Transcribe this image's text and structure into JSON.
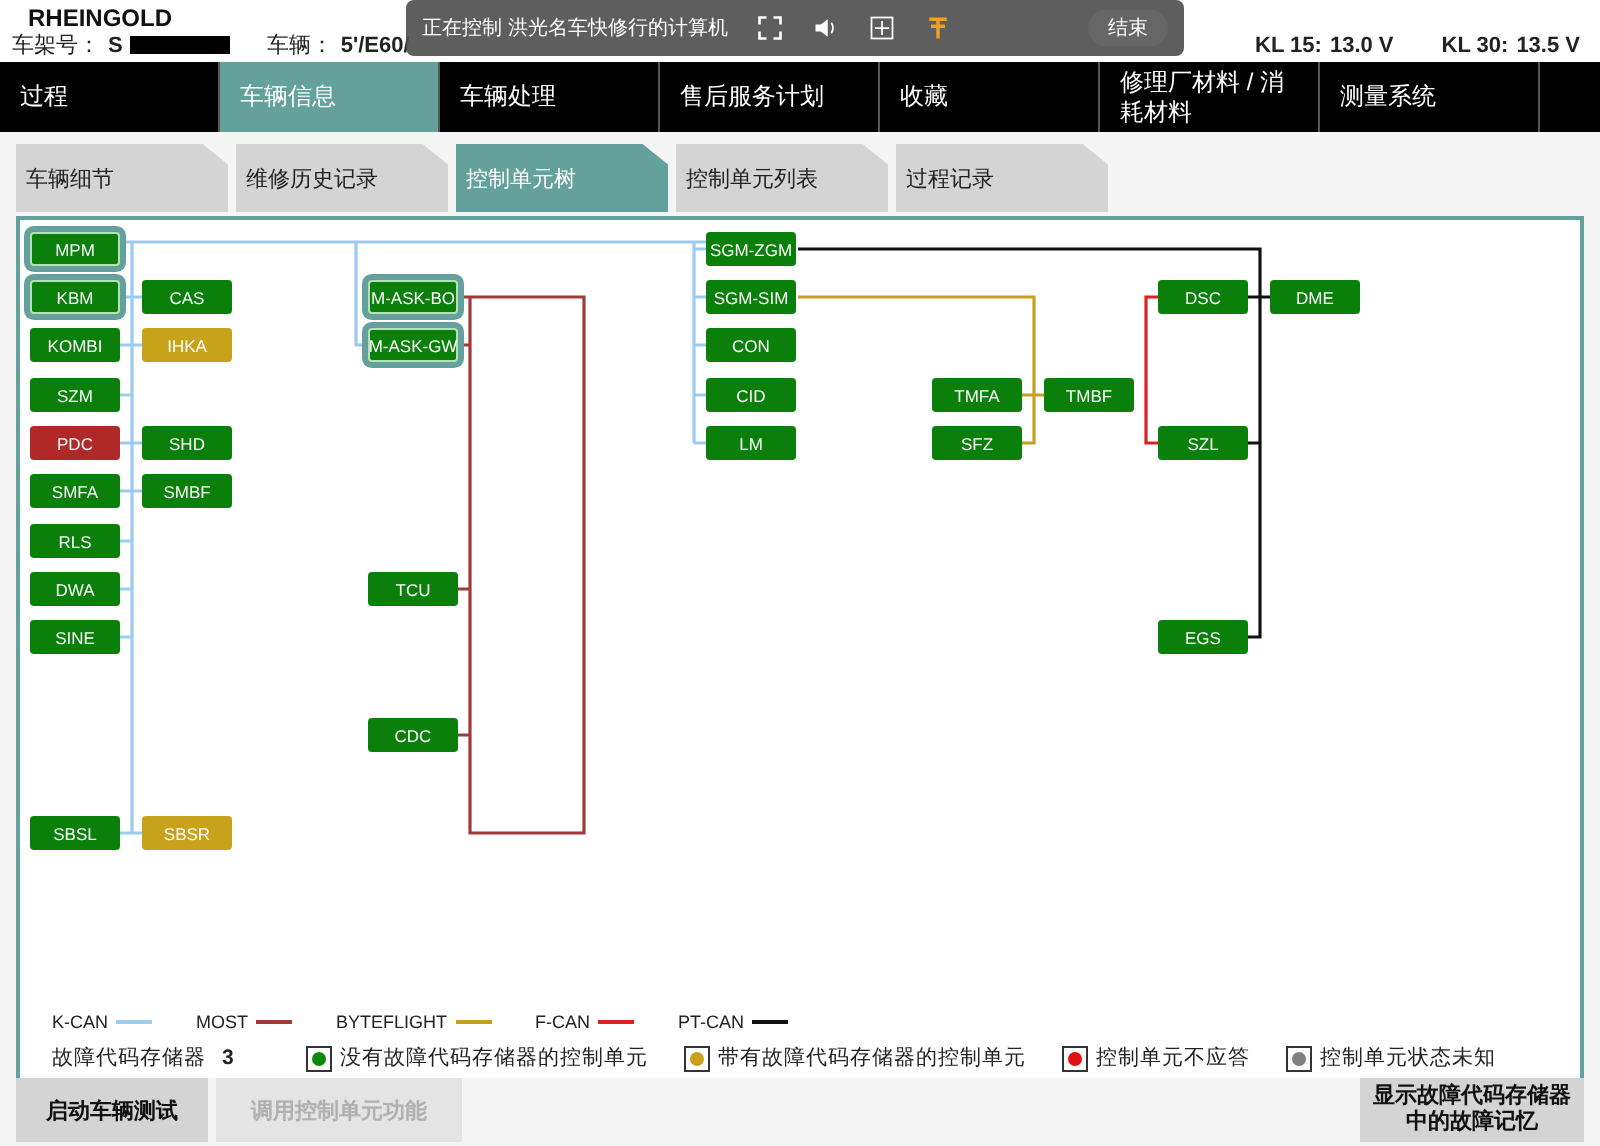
{
  "app_title": "RHEINGOLD",
  "vehicle_bar": {
    "chassis_label": "车架号：",
    "chassis_value": "S",
    "vehicle_label": "车辆：",
    "vehicle_value": "5'/E60/",
    "kl15_label": "KL 15:",
    "kl15_value": "13.0 V",
    "kl30_label": "KL 30:",
    "kl30_value": "13.5 V"
  },
  "remote_toolbar": {
    "text": "正在控制 洪光名车快修行的计算机",
    "end_button": "结束"
  },
  "menu": [
    {
      "label": "过程",
      "selected": false
    },
    {
      "label": "车辆信息",
      "selected": true
    },
    {
      "label": "车辆处理",
      "selected": false
    },
    {
      "label": "售后服务计划",
      "selected": false
    },
    {
      "label": "收藏",
      "selected": false
    },
    {
      "label": "修理厂材料 / 消耗材料",
      "selected": false
    },
    {
      "label": "测量系统",
      "selected": false
    }
  ],
  "tabs": [
    {
      "label": "车辆细节",
      "selected": false
    },
    {
      "label": "维修历史记录",
      "selected": false
    },
    {
      "label": "控制单元树",
      "selected": true
    },
    {
      "label": "控制单元列表",
      "selected": false
    },
    {
      "label": "过程记录",
      "selected": false
    }
  ],
  "nodes": [
    {
      "label": "MPM",
      "kind": "ok",
      "highlighted": true
    },
    {
      "label": "KBM",
      "kind": "ok",
      "highlighted": true
    },
    {
      "label": "CAS",
      "kind": "ok",
      "highlighted": false
    },
    {
      "label": "KOMBI",
      "kind": "ok",
      "highlighted": false
    },
    {
      "label": "IHKA",
      "kind": "fault",
      "highlighted": false
    },
    {
      "label": "SZM",
      "kind": "ok",
      "highlighted": false
    },
    {
      "label": "PDC",
      "kind": "no_response",
      "highlighted": false
    },
    {
      "label": "SHD",
      "kind": "ok",
      "highlighted": false
    },
    {
      "label": "SMFA",
      "kind": "ok",
      "highlighted": false
    },
    {
      "label": "SMBF",
      "kind": "ok",
      "highlighted": false
    },
    {
      "label": "RLS",
      "kind": "ok",
      "highlighted": false
    },
    {
      "label": "DWA",
      "kind": "ok",
      "highlighted": false
    },
    {
      "label": "SINE",
      "kind": "ok",
      "highlighted": false
    },
    {
      "label": "SBSL",
      "kind": "ok",
      "highlighted": false
    },
    {
      "label": "SBSR",
      "kind": "fault",
      "highlighted": false
    },
    {
      "label": "M-ASK-BO",
      "kind": "ok",
      "highlighted": true
    },
    {
      "label": "M-ASK-GW",
      "kind": "ok",
      "highlighted": true
    },
    {
      "label": "TCU",
      "kind": "ok",
      "highlighted": false
    },
    {
      "label": "CDC",
      "kind": "ok",
      "highlighted": false
    },
    {
      "label": "SGM-ZGM",
      "kind": "ok",
      "highlighted": false
    },
    {
      "label": "SGM-SIM",
      "kind": "ok",
      "highlighted": false
    },
    {
      "label": "CON",
      "kind": "ok",
      "highlighted": false
    },
    {
      "label": "CID",
      "kind": "ok",
      "highlighted": false
    },
    {
      "label": "LM",
      "kind": "ok",
      "highlighted": false
    },
    {
      "label": "TMFA",
      "kind": "ok",
      "highlighted": false
    },
    {
      "label": "SFZ",
      "kind": "ok",
      "highlighted": false
    },
    {
      "label": "TMBF",
      "kind": "ok",
      "highlighted": false
    },
    {
      "label": "DSC",
      "kind": "ok",
      "highlighted": false
    },
    {
      "label": "DME",
      "kind": "ok",
      "highlighted": false
    },
    {
      "label": "SZL",
      "kind": "ok",
      "highlighted": false
    },
    {
      "label": "EGS",
      "kind": "ok",
      "highlighted": false
    }
  ],
  "buses": [
    {
      "name": "K-CAN",
      "color": "#9ccbf0"
    },
    {
      "name": "MOST",
      "color": "#a03a3a"
    },
    {
      "name": "BYTEFLIGHT",
      "color": "#c8a020"
    },
    {
      "name": "F-CAN",
      "color": "#e02020"
    },
    {
      "name": "PT-CAN",
      "color": "#111111"
    }
  ],
  "fault_memory": {
    "label": "故障代码存储器",
    "count": "3"
  },
  "status_legend": [
    {
      "label": "没有故障代码存储器的控制单元",
      "color": "#0a8a0a"
    },
    {
      "label": "带有故障代码存储器的控制单元",
      "color": "#c8a21a"
    },
    {
      "label": "控制单元不应答",
      "color": "#e01010"
    },
    {
      "label": "控制单元状态未知",
      "color": "#808080"
    }
  ],
  "buttons": [
    {
      "label": "启动车辆测试",
      "disabled": false
    },
    {
      "label": "调用控制单元功能",
      "disabled": true
    },
    {
      "label": "显示故障代码存储器中的故障记忆",
      "disabled": false
    }
  ]
}
